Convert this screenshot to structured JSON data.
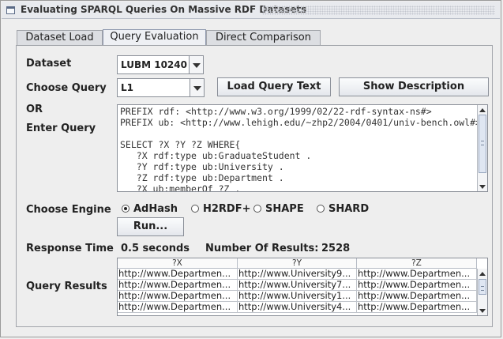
{
  "window": {
    "title": "Evaluating SPARQL Queries On Massive RDF Datasets"
  },
  "tabs": [
    {
      "label": "Dataset Load"
    },
    {
      "label": "Query Evaluation"
    },
    {
      "label": "Direct Comparison"
    }
  ],
  "form": {
    "dataset_label": "Dataset",
    "dataset_value": "LUBM 10240",
    "choose_query_label": "Choose Query",
    "query_value": "L1",
    "load_query_button": "Load Query Text",
    "show_description_button": "Show Description",
    "or_label": "OR",
    "enter_query_label": "Enter Query",
    "query_text": "PREFIX rdf: <http://www.w3.org/1999/02/22-rdf-syntax-ns#>\nPREFIX ub: <http://www.lehigh.edu/~zhp2/2004/0401/univ-bench.owl#>\n\nSELECT ?X ?Y ?Z WHERE{\n   ?X rdf:type ub:GraduateStudent .\n   ?Y rdf:type ub:University .\n   ?Z rdf:type ub:Department .\n   ?X ub:memberOf ?Z .",
    "choose_engine_label": "Choose Engine",
    "engines": [
      {
        "label": "AdHash",
        "selected": true
      },
      {
        "label": "H2RDF+",
        "selected": false
      },
      {
        "label": "SHAPE",
        "selected": false
      },
      {
        "label": "SHARD",
        "selected": false
      }
    ],
    "run_button": "Run...",
    "response_time_label": "Response Time",
    "response_time_value": "0.5 seconds",
    "num_results_label": "Number Of Results:",
    "num_results_value": "2528",
    "query_results_label": "Query Results"
  },
  "results": {
    "columns": [
      "?X",
      "?Y",
      "?Z"
    ],
    "rows": [
      [
        "http://www.Departmen...",
        "http://www.University9...",
        "http://www.Departmen..."
      ],
      [
        "http://www.Departmen...",
        "http://www.University7...",
        "http://www.Departmen..."
      ],
      [
        "http://www.Departmen...",
        "http://www.University1...",
        "http://www.Departmen..."
      ],
      [
        "http://www.Departmen...",
        "http://www.University4...",
        "http://www.Departmen..."
      ]
    ]
  },
  "colors": {
    "panel_bg": "#eeeeee",
    "border": "#8a8f98",
    "active_tab": "#eef0f4"
  }
}
